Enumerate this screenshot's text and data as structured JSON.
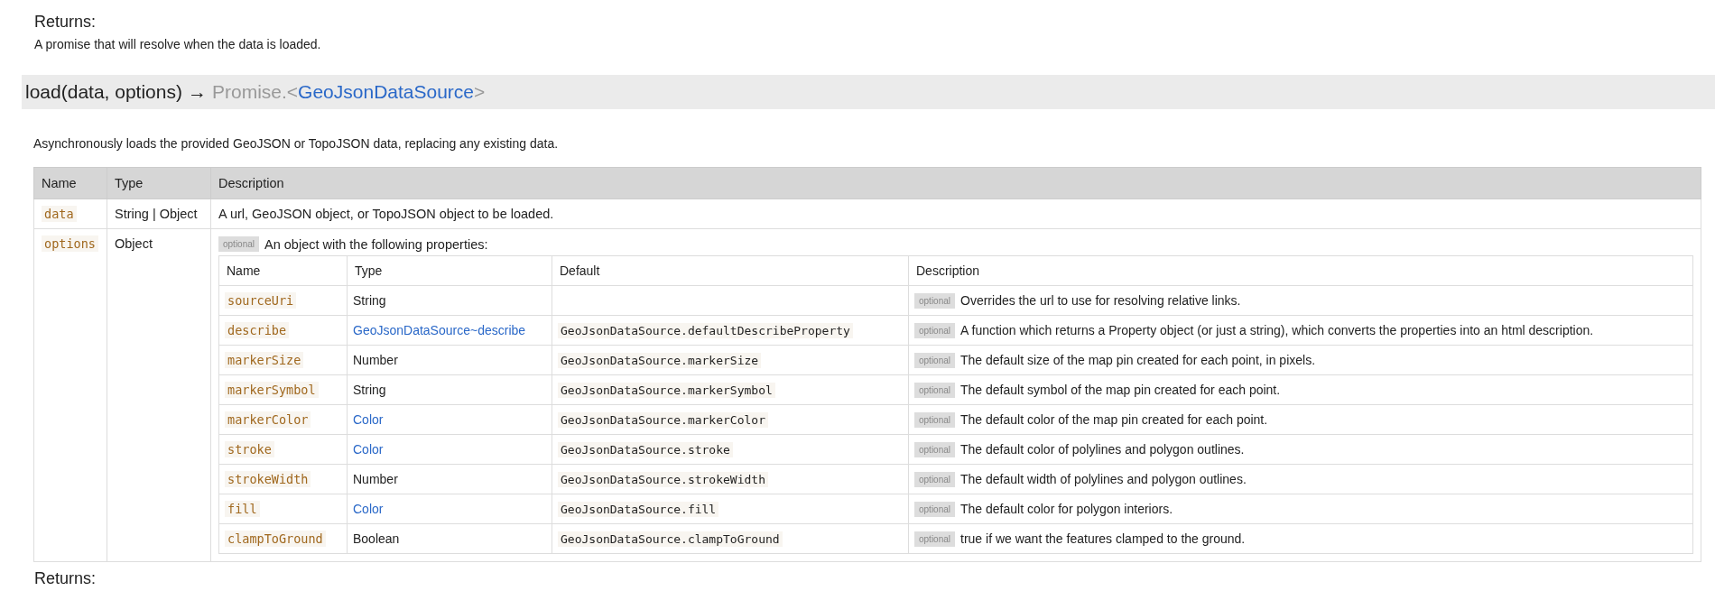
{
  "returns_top": {
    "heading": "Returns:",
    "text": "A promise that will resolve when the data is loaded."
  },
  "signature": {
    "name": "load(data, options)",
    "arrow": "→",
    "type_prefix": "Promise.<",
    "type_link": "GeoJsonDataSource",
    "type_suffix": ">"
  },
  "description": "Asynchronously loads the provided GeoJSON or TopoJSON data, replacing any existing data.",
  "params_table": {
    "columns": [
      "Name",
      "Type",
      "Description"
    ],
    "rows": [
      {
        "name": "data",
        "type": "String | Object",
        "description": "A url, GeoJSON object, or TopoJSON object to be loaded."
      },
      {
        "name": "options",
        "type": "Object",
        "badge": "optional",
        "description": "An object with the following properties:",
        "properties": {
          "columns": [
            "Name",
            "Type",
            "Default",
            "Description"
          ],
          "rows": [
            {
              "name": "sourceUri",
              "type": "String",
              "kind": "plain",
              "badge": "optional",
              "description": "Overrides the url to use for resolving relative links."
            },
            {
              "name": "describe",
              "type": "GeoJsonDataSource~describe",
              "kind": "link",
              "default": "GeoJsonDataSource.defaultDescribeProperty",
              "badge": "optional",
              "description": "A function which returns a Property object (or just a string), which converts the properties into an html description."
            },
            {
              "name": "markerSize",
              "type": "Number",
              "kind": "plain",
              "default": "GeoJsonDataSource.markerSize",
              "badge": "optional",
              "description": "The default size of the map pin created for each point, in pixels."
            },
            {
              "name": "markerSymbol",
              "type": "String",
              "kind": "plain",
              "default": "GeoJsonDataSource.markerSymbol",
              "badge": "optional",
              "description": "The default symbol of the map pin created for each point."
            },
            {
              "name": "markerColor",
              "type": "Color",
              "kind": "link",
              "default": "GeoJsonDataSource.markerColor",
              "badge": "optional",
              "description": "The default color of the map pin created for each point."
            },
            {
              "name": "stroke",
              "type": "Color",
              "kind": "link",
              "default": "GeoJsonDataSource.stroke",
              "badge": "optional",
              "description": "The default color of polylines and polygon outlines."
            },
            {
              "name": "strokeWidth",
              "type": "Number",
              "kind": "plain",
              "default": "GeoJsonDataSource.strokeWidth",
              "badge": "optional",
              "description": "The default width of polylines and polygon outlines."
            },
            {
              "name": "fill",
              "type": "Color",
              "kind": "link",
              "default": "GeoJsonDataSource.fill",
              "badge": "optional",
              "description": "The default color for polygon interiors."
            },
            {
              "name": "clampToGround",
              "type": "Boolean",
              "kind": "plain",
              "default": "GeoJsonDataSource.clampToGround",
              "badge": "optional",
              "description": "true if we want the features clamped to the ground."
            }
          ]
        }
      }
    ]
  },
  "returns_bottom": {
    "heading": "Returns:"
  }
}
